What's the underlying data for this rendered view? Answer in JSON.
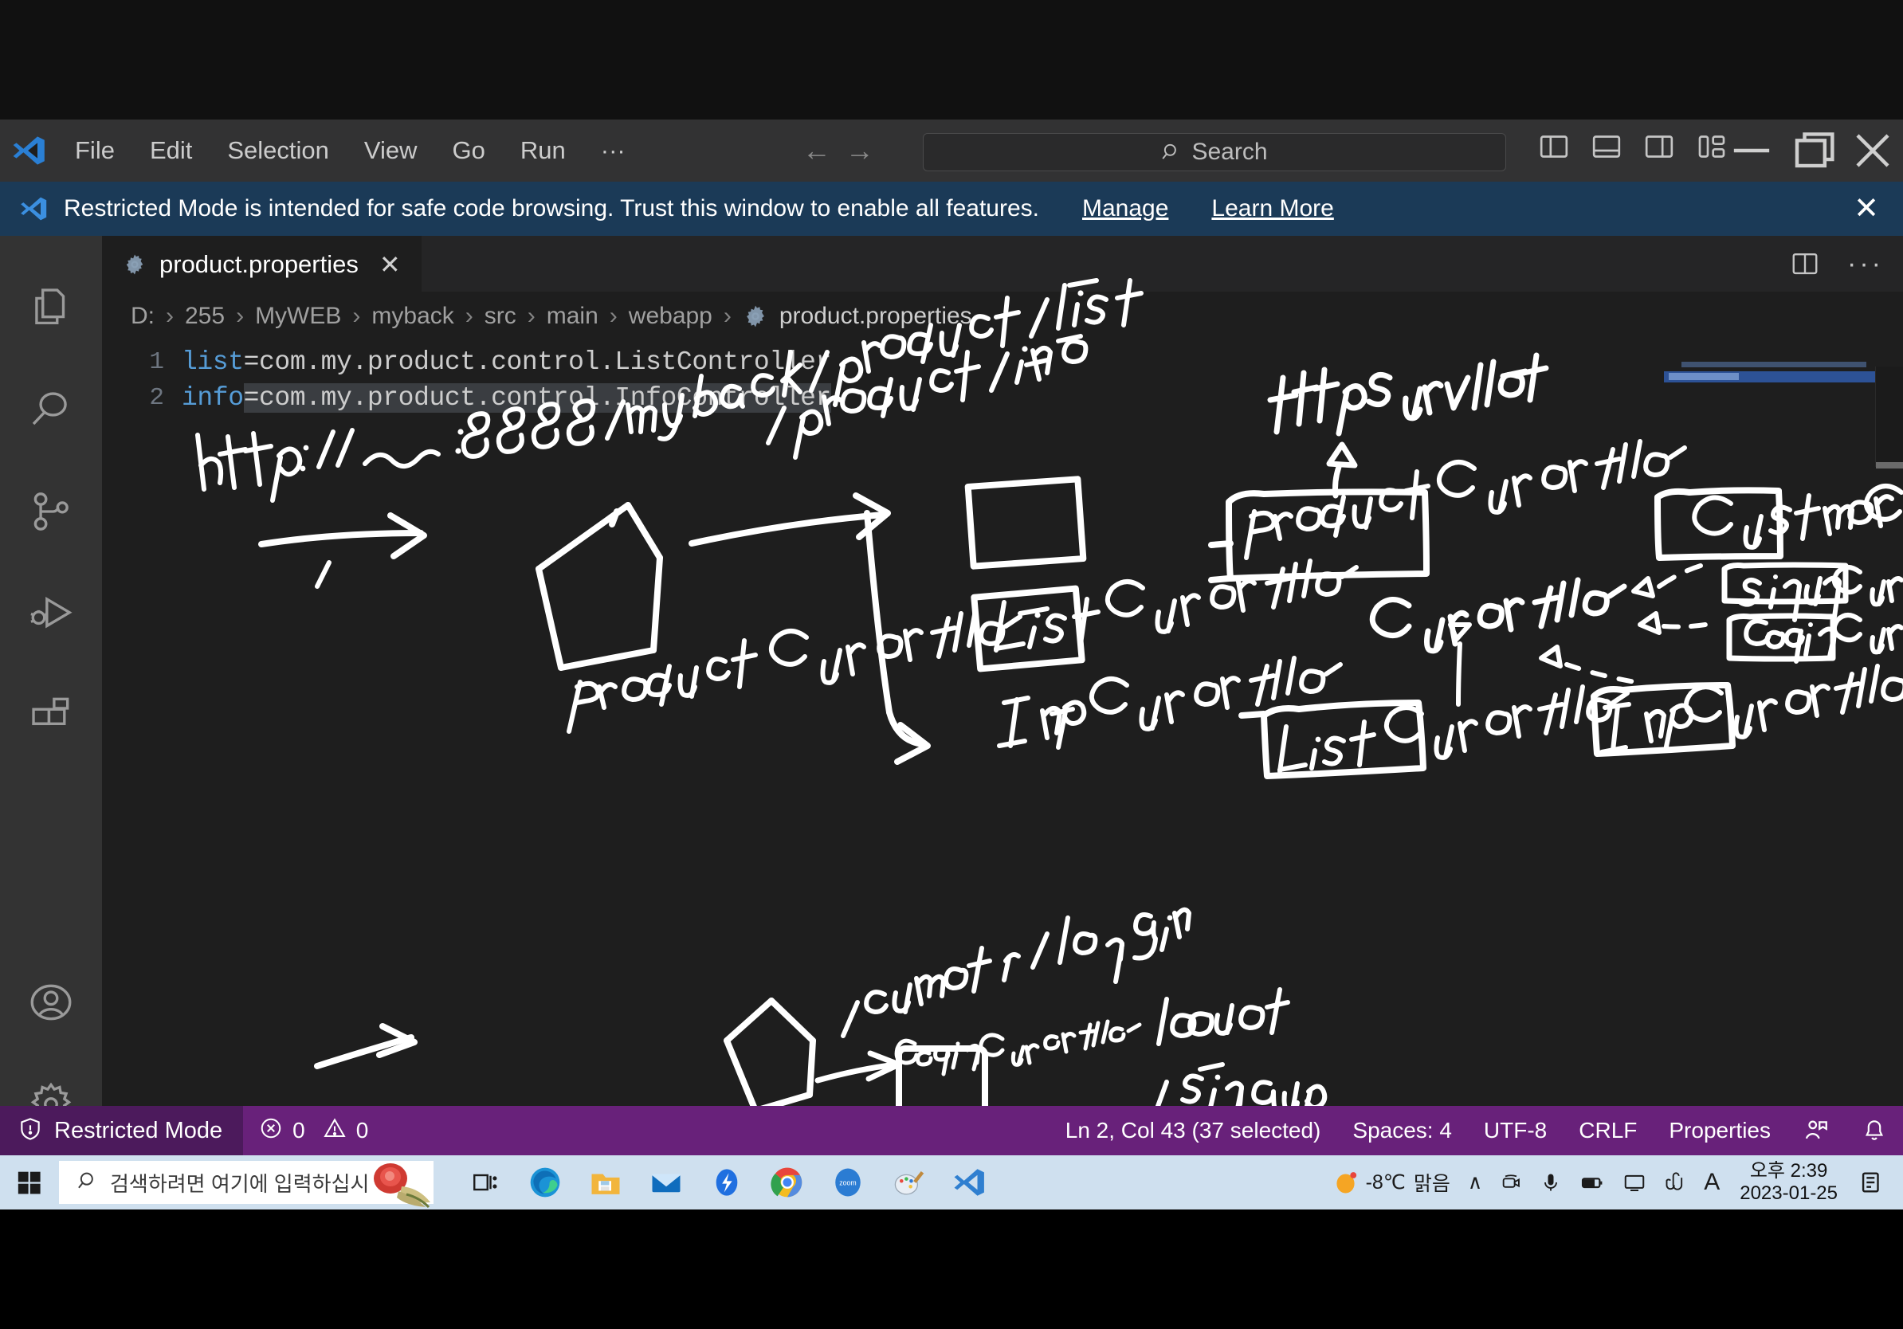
{
  "window": {
    "app": "Visual Studio Code",
    "menus": [
      "File",
      "Edit",
      "Selection",
      "View",
      "Go",
      "Run",
      "···"
    ],
    "nav_back": "←",
    "nav_forward": "→",
    "search_placeholder": "Search",
    "layout_buttons": [
      "toggle-primary-sidebar",
      "toggle-panel",
      "toggle-secondary-sidebar",
      "customize-layout"
    ],
    "controls": {
      "minimize": "—",
      "maximize": "❐",
      "close": "✕"
    }
  },
  "banner": {
    "message": "Restricted Mode is intended for safe code browsing. Trust this window to enable all features.",
    "manage": "Manage",
    "learn_more": "Learn More",
    "close": "✕"
  },
  "activity_bar": {
    "items": [
      {
        "name": "explorer",
        "icon": "files-icon"
      },
      {
        "name": "search",
        "icon": "search-icon"
      },
      {
        "name": "source-control",
        "icon": "source-control-icon"
      },
      {
        "name": "run-and-debug",
        "icon": "debug-icon"
      },
      {
        "name": "extensions",
        "icon": "extensions-icon"
      },
      {
        "name": "accounts",
        "icon": "account-icon"
      },
      {
        "name": "settings",
        "icon": "gear-icon"
      }
    ]
  },
  "tabs": {
    "active": "product.properties",
    "close_glyph": "✕",
    "actions": [
      "split-editor",
      "more-actions"
    ],
    "more_glyph": "···"
  },
  "breadcrumb": {
    "separator": "›",
    "items": [
      "D:",
      "255",
      "MyWEB",
      "myback",
      "src",
      "main",
      "webapp",
      "product.properties"
    ]
  },
  "editor": {
    "lines": [
      {
        "no": "1",
        "key": "list",
        "eq": "=",
        "value": "com.my.product.control.ListController",
        "selected": false
      },
      {
        "no": "2",
        "key": "info",
        "eq": "=",
        "value": "com.my.product.control.InfoController",
        "selected": true
      }
    ]
  },
  "annotations": {
    "url_line1": "http://  ~~:8888/myback/product/list",
    "url_line2": "/ product / info",
    "product_controller": "Product Controller",
    "list_controller": "ListController",
    "info_controller": "InfoController",
    "http_servlet": "HttpServlet",
    "right_product_controller": "ProductController",
    "customer_controller": "CustomerController",
    "controller": "Controller",
    "signup_controller_box": "SignupController",
    "login_controller_box": "LoginController",
    "right_list_controller": "ListController",
    "right_info_controller": "InfoController",
    "customer_login": "/customer/login",
    "login_controller_small": "LoginController",
    "logout": "logout",
    "signup": "/ sinqup",
    "signup_controller": "SignupController"
  },
  "status_bar": {
    "restricted_mode": "Restricted Mode",
    "errors": "0",
    "warnings": "0",
    "cursor": "Ln 2, Col 43 (37 selected)",
    "indentation": "Spaces: 4",
    "encoding": "UTF-8",
    "eol": "CRLF",
    "language": "Properties",
    "feedback_icon": "remote-feedback-icon",
    "bell_icon": "bell-icon",
    "accent_color": "#68217a",
    "trust_color": "#4c1a5c"
  },
  "taskbar": {
    "search_placeholder": "검색하려면 여기에 입력하십시",
    "pinned": [
      {
        "name": "task-view-icon"
      },
      {
        "name": "microsoft-edge-icon"
      },
      {
        "name": "file-explorer-icon"
      },
      {
        "name": "mail-icon"
      },
      {
        "name": "bitdefender-icon"
      },
      {
        "name": "google-chrome-icon"
      },
      {
        "name": "zoom-icon",
        "label": "zoom"
      },
      {
        "name": "paint-icon"
      },
      {
        "name": "vscode-icon"
      }
    ],
    "tray": {
      "weather_temp": "-8℃",
      "weather_desc": "맑음",
      "chevron": "∧",
      "icons": [
        "camera-icon",
        "microphone-icon",
        "battery-icon",
        "display-icon",
        "clip-icon",
        "ime-icon"
      ],
      "ime": "A",
      "time": "오후 2:39",
      "date": "2023-01-25",
      "notification_icon": "notification-icon"
    }
  }
}
